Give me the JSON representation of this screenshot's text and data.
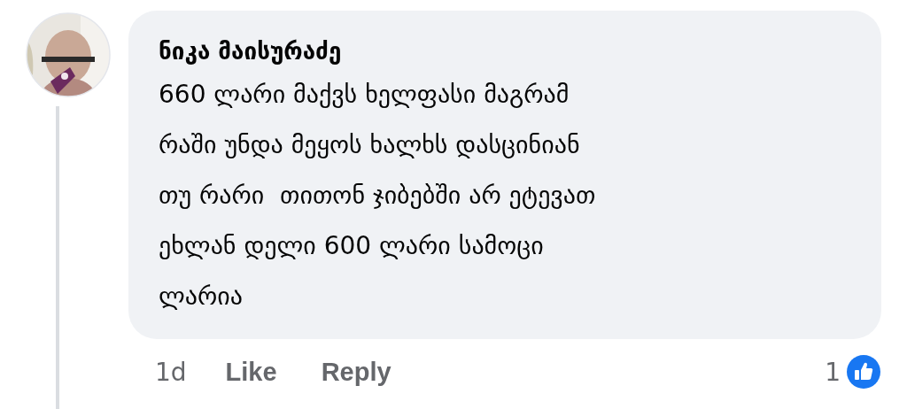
{
  "comment": {
    "author": "ნიკა მაისურაძე",
    "text": "660 ლარი მაქვს ხელფასი მაგრამ\nრაში უნდა მეყოს ხალხს დასცინიან\nთუ რარი  თითონ ჯიბებში არ ეტევათ\nეხლან დელი 600 ლარი სამოცი\nლარია",
    "time": "1d",
    "actions": [
      "Like",
      "Reply"
    ],
    "reaction_count": "1"
  }
}
